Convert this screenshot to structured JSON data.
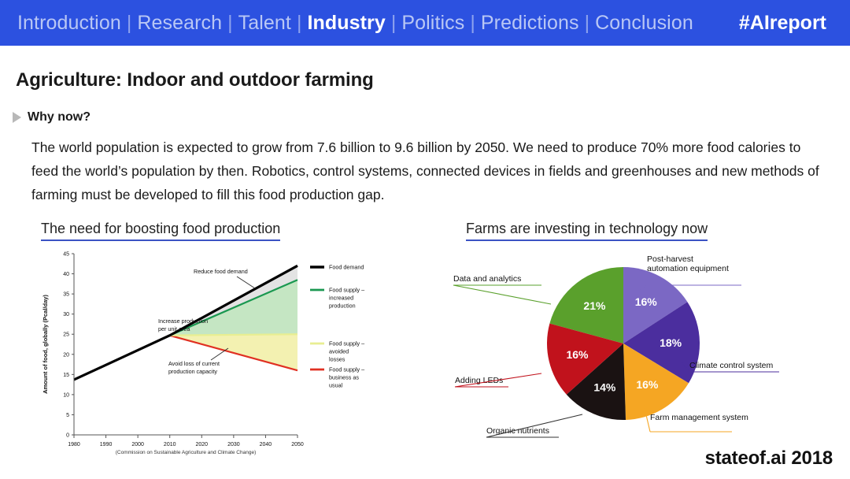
{
  "nav": {
    "separator": "|",
    "items": [
      {
        "label": "Introduction",
        "active": false
      },
      {
        "label": "Research",
        "active": false
      },
      {
        "label": "Talent",
        "active": false
      },
      {
        "label": "Industry",
        "active": true
      },
      {
        "label": "Politics",
        "active": false
      },
      {
        "label": "Predictions",
        "active": false
      },
      {
        "label": "Conclusion",
        "active": false
      }
    ],
    "hashtag": "#AIreport",
    "background_color": "#2c51e0",
    "active_color": "#ffffff",
    "inactive_color": "#b9c7f5"
  },
  "slide": {
    "title": "Agriculture: Indoor and outdoor farming",
    "why_now_label": "Why now?",
    "body": "The world population is expected to grow from 7.6 billion to 9.6 billion by 2050. We need to produce 70% more food calories to feed the world’s population by then. Robotics, control systems, connected devices in fields and greenhouses and new methods of farming must be developed to fill this food production gap.",
    "footer_brand": "stateof.ai 2018",
    "accent_color": "#3b53c4"
  },
  "panels": {
    "left_heading": "The need for boosting food production",
    "right_heading": "Farms are investing in technology now"
  },
  "chart_data": [
    {
      "type": "line",
      "title": "The need for boosting food production",
      "xlabel": "",
      "ylabel": "Amount of food, globally (Pcal/day)",
      "source_note": "(Commission on Sustainable Agriculture and Climate Change)",
      "xlim": [
        1980,
        2050
      ],
      "ylim": [
        0,
        45
      ],
      "xticks": [
        1980,
        1990,
        2000,
        2010,
        2020,
        2030,
        2040,
        2050
      ],
      "yticks": [
        0,
        5,
        10,
        15,
        20,
        25,
        30,
        35,
        40,
        45
      ],
      "grid": false,
      "legend_position": "right",
      "annotations": [
        {
          "text": "Reduce food demand"
        },
        {
          "text": "Increase production per unit area"
        },
        {
          "text": "Avoid loss of current production capacity"
        }
      ],
      "series": [
        {
          "name": "Food demand",
          "color": "#000000",
          "x": [
            1980,
            2010,
            2050
          ],
          "values": [
            13.7,
            24.7,
            42.0
          ]
        },
        {
          "name": "Food supply – increased production",
          "color": "#1a9850",
          "x": [
            1980,
            2010,
            2050
          ],
          "values": [
            13.7,
            24.7,
            38.5
          ]
        },
        {
          "name": "Food supply – avoided losses",
          "color": "#e8ee92",
          "x": [
            1980,
            2010,
            2050
          ],
          "values": [
            13.7,
            24.7,
            25.0
          ]
        },
        {
          "name": "Food supply – business as usual",
          "color": "#e03022",
          "x": [
            1980,
            2010,
            2050
          ],
          "values": [
            13.7,
            24.7,
            16.0
          ]
        }
      ]
    },
    {
      "type": "pie",
      "title": "Farms are investing in technology now",
      "legend_position": "callouts",
      "slices": [
        {
          "label": "Data and analytics",
          "value": 21,
          "display": "21%",
          "color": "#5aa02c"
        },
        {
          "label": "Post-harvest automation equipment",
          "value": 16,
          "display": "16%",
          "color": "#7b68c4"
        },
        {
          "label": "Climate control system",
          "value": 18,
          "display": "18%",
          "color": "#4b2e9e"
        },
        {
          "label": "Farm management system",
          "value": 16,
          "display": "16%",
          "color": "#f5a623"
        },
        {
          "label": "Organic nutrients",
          "value": 14,
          "display": "14%",
          "color": "#1a1212"
        },
        {
          "label": "Adding LEDs",
          "value": 16,
          "display": "16%",
          "color": "#c1121c"
        }
      ]
    }
  ]
}
